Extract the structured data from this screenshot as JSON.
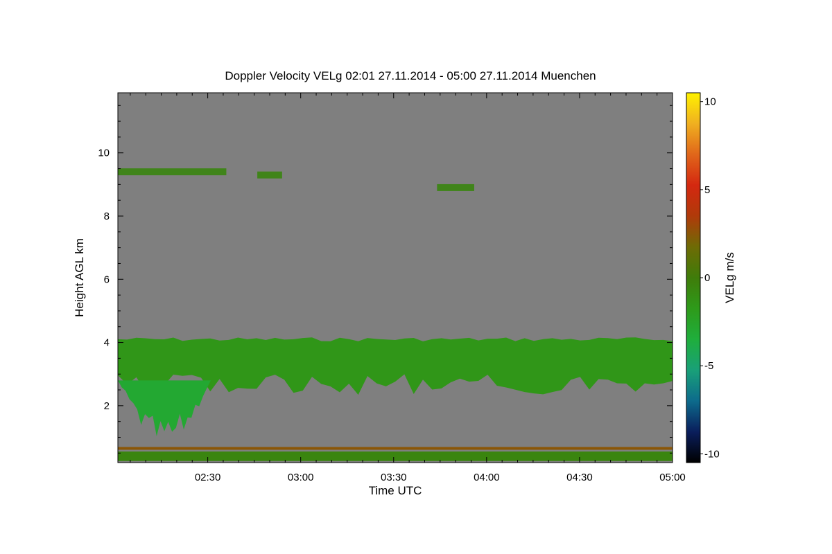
{
  "chart_data": {
    "type": "heatmap",
    "title": "Doppler Velocity VELg   02:01 27.11.2014 - 05:00 27.11.2014 Muenchen",
    "xlabel": "Time UTC",
    "ylabel": "Height AGL km",
    "x_range": [
      "02:01",
      "05:00"
    ],
    "x_ticks": [
      "02:30",
      "03:00",
      "03:30",
      "04:00",
      "04:30",
      "05:00"
    ],
    "y_range": [
      0.2,
      11.9
    ],
    "y_ticks": [
      2,
      4,
      6,
      8,
      10
    ],
    "colorbar": {
      "label": "VELg m/s",
      "range": [
        -10.5,
        10.5
      ],
      "ticks": [
        -10,
        -5,
        0,
        5,
        10
      ],
      "colors": [
        "#000000",
        "#0a1e5c",
        "#0d6b8c",
        "#19a078",
        "#1fae3c",
        "#2e9a1a",
        "#3f7c0a",
        "#6e6b05",
        "#b03a0a",
        "#d42810",
        "#e0661a",
        "#f0b020",
        "#fff200"
      ]
    },
    "background_color": "#7f7f7f",
    "features": [
      {
        "name": "aerosol layer",
        "start": "02:01",
        "end": "05:00",
        "bottom_km": 0.25,
        "top_km": 0.55,
        "velocity_ms": -0.5
      },
      {
        "name": "ceilometer artifact line",
        "start": "02:01",
        "end": "05:00",
        "height_km": 0.65,
        "velocity_ms": 2.5
      },
      {
        "name": "cloud layer",
        "start": "02:01",
        "end": "05:00",
        "top_km": 4.1,
        "base_km": 2.8,
        "velocity_ms": -1.5
      },
      {
        "name": "precipitation fall streak",
        "start": "02:01",
        "end": "02:31",
        "bottom_km": 0.6,
        "velocity_ms": -3.0
      },
      {
        "name": "cirrus",
        "start": "02:01",
        "end": "02:36",
        "height_km": 9.4,
        "velocity_ms": -0.5
      },
      {
        "name": "cirrus",
        "start": "02:46",
        "end": "02:54",
        "height_km": 9.3,
        "velocity_ms": -0.5
      },
      {
        "name": "cirrus",
        "start": "03:44",
        "end": "03:56",
        "height_km": 8.9,
        "velocity_ms": -0.5
      }
    ]
  }
}
